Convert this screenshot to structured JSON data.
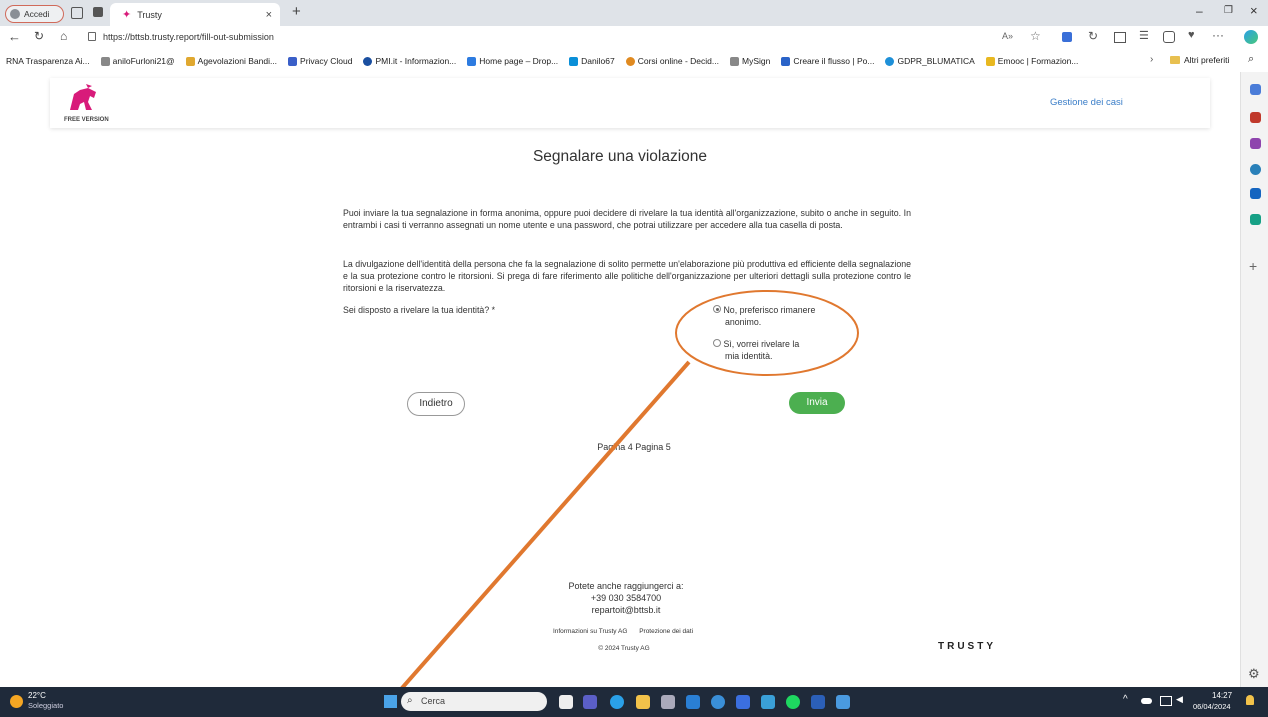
{
  "browser": {
    "profile_label": "Accedi",
    "tab_title": "Trusty",
    "url": "https://bttsb.trusty.report/fill-out-submission",
    "bookmarks": [
      "RNA Trasparenza Ai...",
      "aniloFurloni21@",
      "Agevolazioni Bandi...",
      "Privacy Cloud",
      "PMI.it - Informazion...",
      "Home page – Drop...",
      "Danilo67",
      "Corsi online - Decid...",
      "MySign",
      "Creare il flusso | Po...",
      "GDPR_BLUMATICA",
      "Emooc | Formazion..."
    ],
    "other_favorites": "Altri preferiti"
  },
  "header": {
    "logo_caption": "FREE VERSION",
    "nav_link": "Gestione dei casi"
  },
  "form": {
    "title": "Segnalare una violazione",
    "para1": "Puoi inviare la tua segnalazione in forma anonima, oppure puoi decidere di rivelare la tua identità all'organizzazione, subito o anche in seguito. In entrambi i casi ti verranno assegnati un nome utente e una password, che potrai utilizzare per accedere alla tua casella di posta.",
    "para2": "La divulgazione dell'identità della persona che fa la segnalazione di solito permette un'elaborazione più produttiva ed efficiente della segnalazione e la sua protezione contro le ritorsioni. Si prega di fare riferimento alle politiche dell'organizzazione per ulteriori dettagli sulla protezione contro le ritorsioni e la riservatezza.",
    "question": "Sei disposto a rivelare la tua identità? *",
    "option_no_line1": "No, preferisco rimanere",
    "option_no_line2": "anonimo.",
    "option_yes_line1": "Sì, vorrei rivelare la",
    "option_yes_line2": "mia identità.",
    "back_label": "Indietro",
    "submit_label": "Invia",
    "page_info": "Pagina 4 Pagina 5"
  },
  "footer": {
    "contact_heading": "Potete anche raggiungerci a:",
    "phone": "+39 030 3584700",
    "email": "repartoit@bttsb.it",
    "link_info": "Informazioni su Trusty AG",
    "link_privacy": "Protezione dei dati",
    "copyright": "© 2024 Trusty AG",
    "brand": "TRUSTY"
  },
  "taskbar": {
    "weather_temp": "22°C",
    "weather_desc": "Soleggiato",
    "search_placeholder": "Cerca",
    "time": "14:27",
    "date": "06/04/2024"
  },
  "colors": {
    "annotation": "#e0782f",
    "submit_green": "#4caf50",
    "logo_pink": "#d81b7a",
    "link_blue": "#3b7ec8"
  }
}
